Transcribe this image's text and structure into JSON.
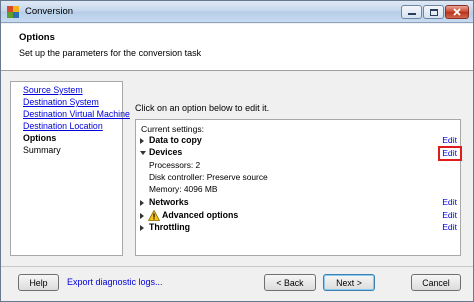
{
  "window": {
    "title": "Conversion",
    "icon": "vmware-converter-icon"
  },
  "header": {
    "title": "Options",
    "subtitle": "Set up the parameters for the conversion task"
  },
  "nav": {
    "items": [
      {
        "label": "Source System",
        "state": "link"
      },
      {
        "label": "Destination System",
        "state": "link"
      },
      {
        "label": "Destination Virtual Machine",
        "state": "link"
      },
      {
        "label": "Destination Location",
        "state": "link"
      },
      {
        "label": "Options",
        "state": "current"
      },
      {
        "label": "Summary",
        "state": "plain"
      }
    ]
  },
  "main": {
    "instruction": "Click on an option below to edit it.",
    "panel_heading": "Current settings:",
    "sections": [
      {
        "label": "Data to copy",
        "expanded": false,
        "edit": "Edit"
      },
      {
        "label": "Devices",
        "expanded": true,
        "edit": "Edit",
        "details": [
          "Processors: 2",
          "Disk controller: Preserve source",
          "Memory: 4096 MB"
        ]
      },
      {
        "label": "Networks",
        "expanded": false,
        "edit": "Edit"
      },
      {
        "label": "Advanced options",
        "expanded": false,
        "edit": "Edit",
        "icon": "warning-icon"
      },
      {
        "label": "Throttling",
        "expanded": false,
        "edit": "Edit"
      }
    ]
  },
  "footer": {
    "help": "Help",
    "diagnostic": "Export diagnostic logs...",
    "back": "< Back",
    "next": "Next >",
    "cancel": "Cancel"
  },
  "colors": {
    "link": "#0000dd",
    "highlight": "#e01b1b"
  }
}
